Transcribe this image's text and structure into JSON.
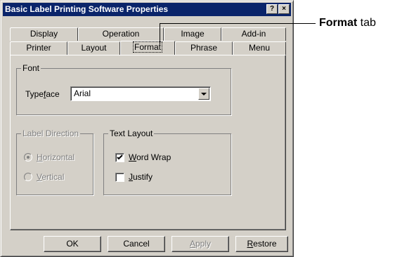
{
  "window": {
    "title": "Basic Label Printing Software Properties",
    "help_button": "?",
    "close_button": "×"
  },
  "tabs": {
    "back_row": [
      "Display",
      "Operation",
      "Image",
      "Add-in"
    ],
    "front_row": [
      "Printer",
      "Layout",
      "Format",
      "Phrase",
      "Menu"
    ],
    "active": "Format"
  },
  "font_group": {
    "label": "Font",
    "typeface_label_pre": "Type",
    "typeface_label_key": "f",
    "typeface_label_post": "ace",
    "typeface_value": "Arial"
  },
  "label_direction": {
    "label": "Label Direction",
    "horizontal": {
      "key": "H",
      "rest": "orizontal",
      "checked": true
    },
    "vertical": {
      "key": "V",
      "rest": "ertical",
      "checked": false
    },
    "enabled": false
  },
  "text_layout": {
    "label": "Text Layout",
    "word_wrap": {
      "key": "W",
      "rest": "ord Wrap",
      "checked": true
    },
    "justify": {
      "key": "J",
      "rest": "ustify",
      "checked": false
    }
  },
  "buttons": {
    "ok": "OK",
    "cancel": "Cancel",
    "apply_key": "A",
    "apply_rest": "pply",
    "restore_key": "R",
    "restore_rest": "estore"
  },
  "callout": {
    "bold": "Format",
    "rest": " tab"
  }
}
